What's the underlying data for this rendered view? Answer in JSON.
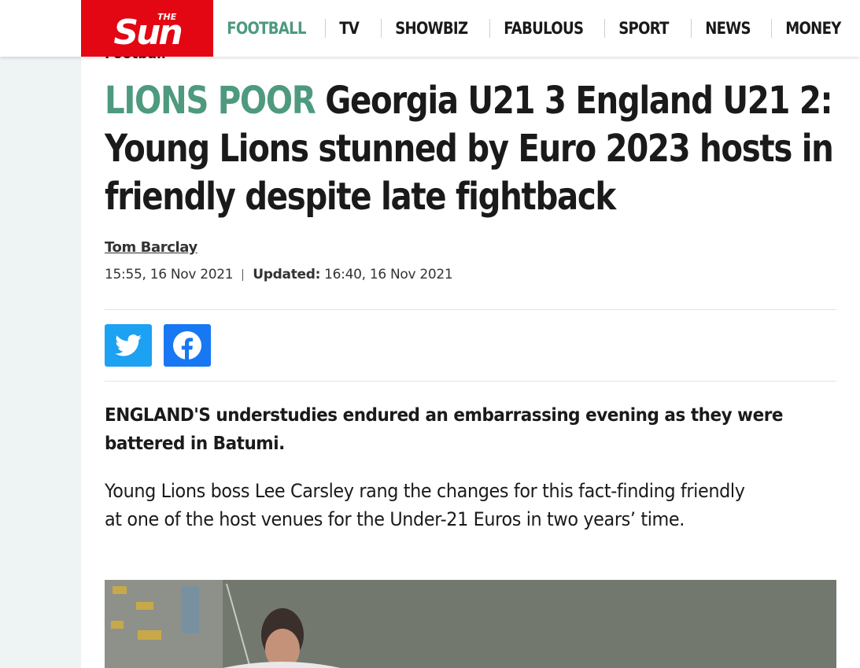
{
  "brand": {
    "logo_text": "The Sun",
    "logo_color": "#e30613",
    "accent_color": "#4e9a7e"
  },
  "nav": {
    "items": [
      {
        "label": "FOOTBALL",
        "active": true
      },
      {
        "label": "TV",
        "active": false
      },
      {
        "label": "SHOWBIZ",
        "active": false
      },
      {
        "label": "FABULOUS",
        "active": false
      },
      {
        "label": "SPORT",
        "active": false
      },
      {
        "label": "NEWS",
        "active": false
      },
      {
        "label": "MONEY",
        "active": false
      }
    ]
  },
  "article": {
    "kicker": "Football",
    "headline_accent": "LIONS POOR",
    "headline_text": "Georgia U21 3 England U21 2: Young Lions stunned by Euro 2023 hosts in friendly despite late fightback",
    "author": "Tom Barclay",
    "published": "15:55, 16 Nov 2021",
    "updated_label": "Updated:",
    "updated": "16:40, 16 Nov 2021",
    "share": {
      "twitter_icon": "twitter-icon",
      "facebook_icon": "facebook-icon"
    },
    "lead": "ENGLAND'S understudies endured an embarrassing evening as they were battered in Batumi.",
    "paragraph": "Young Lions boss Lee Carsley rang the changes for this fact-finding friendly at one of the host venues for the Under-21 Euros in two years’ time."
  }
}
